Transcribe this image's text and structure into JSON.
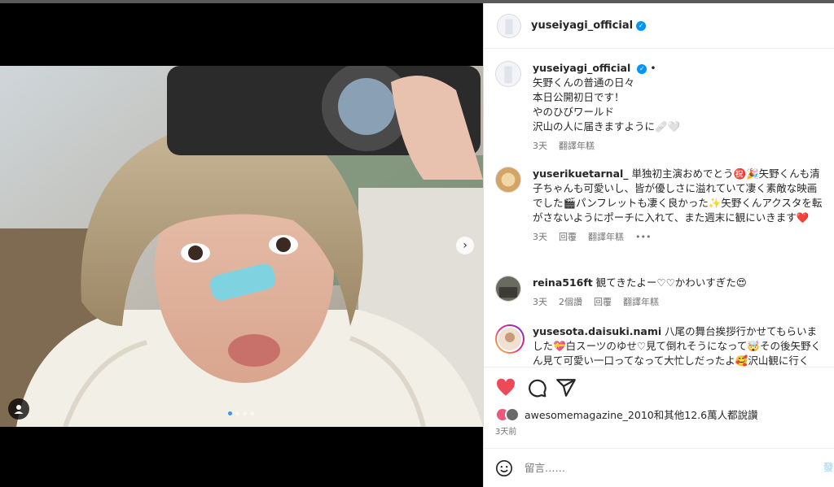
{
  "header": {
    "username": "yuseiyagi_official",
    "more_icon": "more-horizontal-icon"
  },
  "caption": {
    "username": "yuseiyagi_official",
    "separator": "•",
    "lines": [
      "矢野くんの普通の日々",
      "本日公開初日です！",
      "やのひびワールド",
      "沢山の人に届きますように🩹🤍"
    ],
    "time": "3天",
    "translate": "翻譯年糕"
  },
  "comments": [
    {
      "username": "yuserikuetarnal_",
      "text": "単独初主演おめでとう㊗️🎉矢野くんも清子ちゃんも可愛いし、皆が優しさに溢れていて凄く素敵な映画でした🎬パンフレットも凄く良かった✨矢野くんアクスタを転がさないようにポーチに入れて、また週末に観にいきます❤️",
      "time": "3天",
      "reply": "回覆",
      "translate": "翻譯年糕"
    },
    {
      "username": "reina516ft",
      "text": "観てきたよー♡♡かわいすぎた😍",
      "time": "3天",
      "likes": "2個讚",
      "reply": "回覆",
      "translate": "翻譯年糕"
    },
    {
      "username": "yusesota.daisuki.nami",
      "text": "八尾の舞台挨拶行かせてもらいました💝白スーツのゆせ♡見て倒れそうになって🤯その後矢野くん見て可愛い一口ってなって大忙しだったよ🥰沢山観に行く",
      "time": "",
      "reply": "",
      "translate": ""
    }
  ],
  "likes": {
    "text": "awesomemagazine_2010和其他12.6萬人都說讚"
  },
  "date": "3天前",
  "comment_input": {
    "placeholder": "留言……",
    "post_label": "發"
  },
  "colors": {
    "accent": "#0095f6",
    "like": "#ed4956"
  }
}
